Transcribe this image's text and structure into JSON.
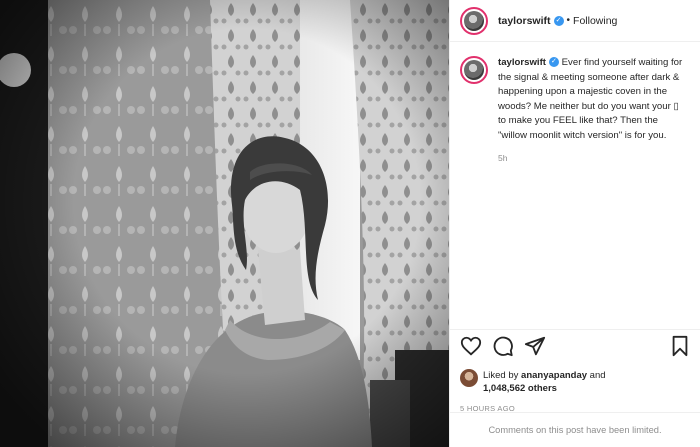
{
  "header": {
    "username": "taylorswift",
    "verified_mark": "✓",
    "separator": "•",
    "follow_status": "Following"
  },
  "caption": {
    "username": "taylorswift",
    "verified_mark": "✓",
    "text": "Ever find yourself waiting for the signal & meeting someone after dark & happening upon a majestic coven in the woods? Me neither but do you want your ▯ to make you FEEL like that? Then the \"willow moonlit witch version\" is for you.",
    "time": "5h"
  },
  "icons": {
    "like": "heart-icon",
    "comment": "comment-icon",
    "share": "send-icon",
    "save": "bookmark-icon"
  },
  "likes": {
    "prefix": "Liked by",
    "user": "ananyapanday",
    "joiner": "and",
    "count": "1,048,562 others"
  },
  "post_age": "5 HOURS AGO",
  "footer": {
    "comments_notice": "Comments on this post have been limited."
  },
  "colors": {
    "ring": "#e1306c",
    "verified": "#3897f0",
    "muted": "#8e8e8e"
  }
}
